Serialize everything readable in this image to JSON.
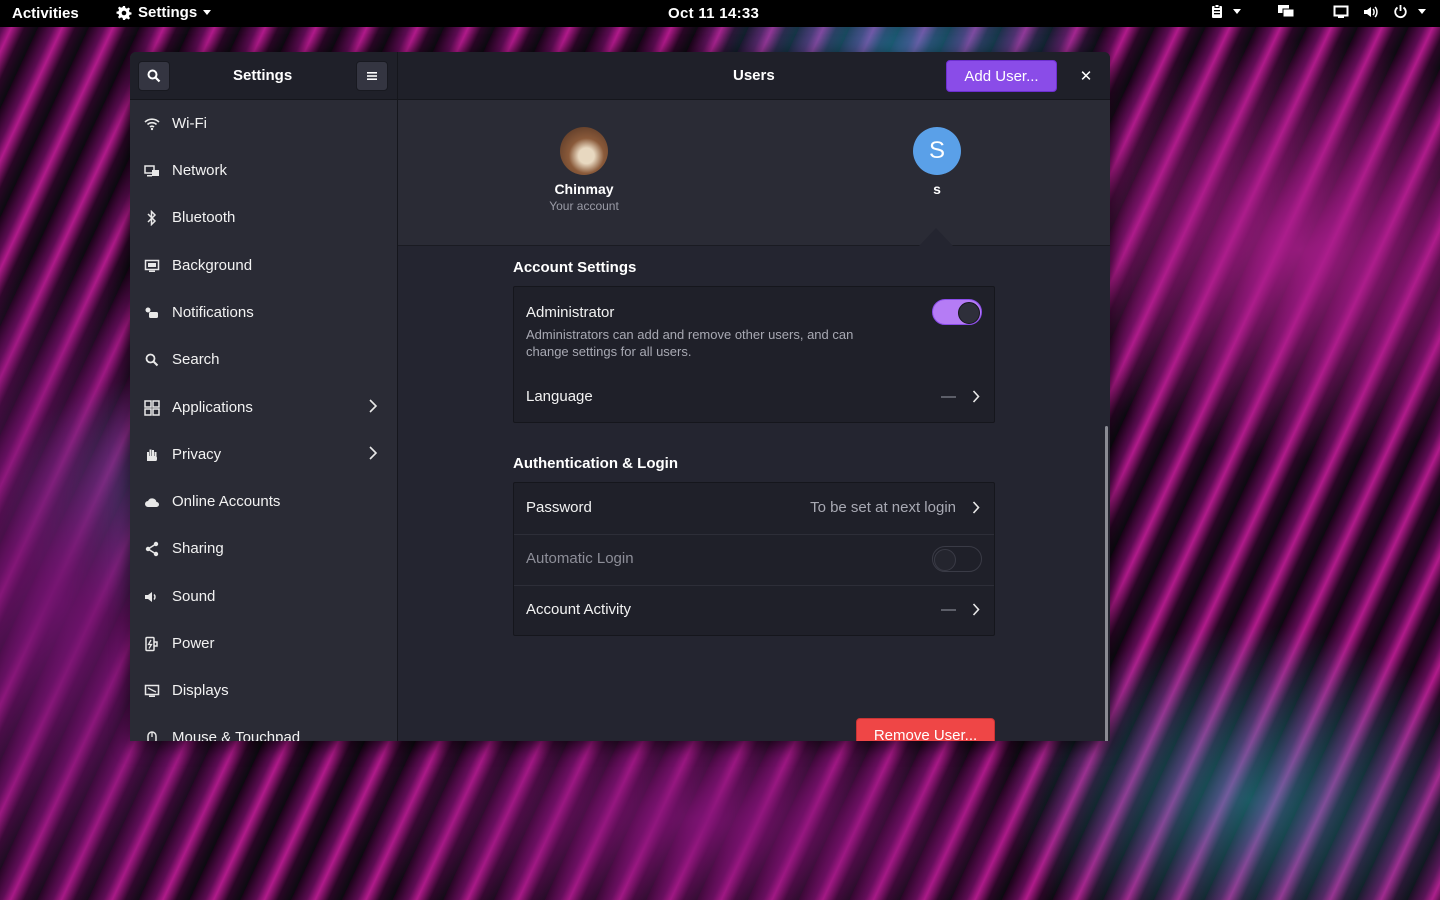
{
  "topbar": {
    "activities": "Activities",
    "app_menu": "Settings",
    "clock": "Oct 11  14:33"
  },
  "window": {
    "sidebar_title": "Settings",
    "page_title": "Users",
    "add_user_label": "Add User...",
    "close_label": "✕"
  },
  "sidebar": {
    "items": [
      {
        "label": "Wi-Fi",
        "icon": "wifi-icon"
      },
      {
        "label": "Network",
        "icon": "network-icon"
      },
      {
        "label": "Bluetooth",
        "icon": "bluetooth-icon"
      },
      {
        "label": "Background",
        "icon": "background-icon"
      },
      {
        "label": "Notifications",
        "icon": "notifications-icon"
      },
      {
        "label": "Search",
        "icon": "search-icon"
      },
      {
        "label": "Applications",
        "icon": "applications-icon"
      },
      {
        "label": "Privacy",
        "icon": "privacy-hand-icon"
      },
      {
        "label": "Online Accounts",
        "icon": "cloud-icon"
      },
      {
        "label": "Sharing",
        "icon": "sharing-icon"
      },
      {
        "label": "Sound",
        "icon": "speaker-icon"
      },
      {
        "label": "Power",
        "icon": "power-plug-icon"
      },
      {
        "label": "Displays",
        "icon": "display-icon"
      },
      {
        "label": "Mouse & Touchpad",
        "icon": "mouse-icon"
      }
    ]
  },
  "users": [
    {
      "name": "Chinmay",
      "subtitle": "Your account"
    },
    {
      "name": "s",
      "initial": "S"
    }
  ],
  "account_settings": {
    "title": "Account Settings",
    "administrator_label": "Administrator",
    "administrator_desc_1": "Administrators can add and remove other users, and can",
    "administrator_desc_2": "change settings for all users.",
    "administrator_on": true,
    "language_label": "Language",
    "language_value": "—"
  },
  "auth": {
    "title": "Authentication & Login",
    "password_label": "Password",
    "password_value": "To be set at next login",
    "auto_login_label": "Automatic Login",
    "auto_login_on": false,
    "activity_label": "Account Activity",
    "activity_value": "—"
  },
  "remove_user_label": "Remove User...",
  "colors": {
    "accent": "#8a4ce8",
    "destructive": "#ef4646",
    "avatar_s": "#5aa0e8"
  }
}
